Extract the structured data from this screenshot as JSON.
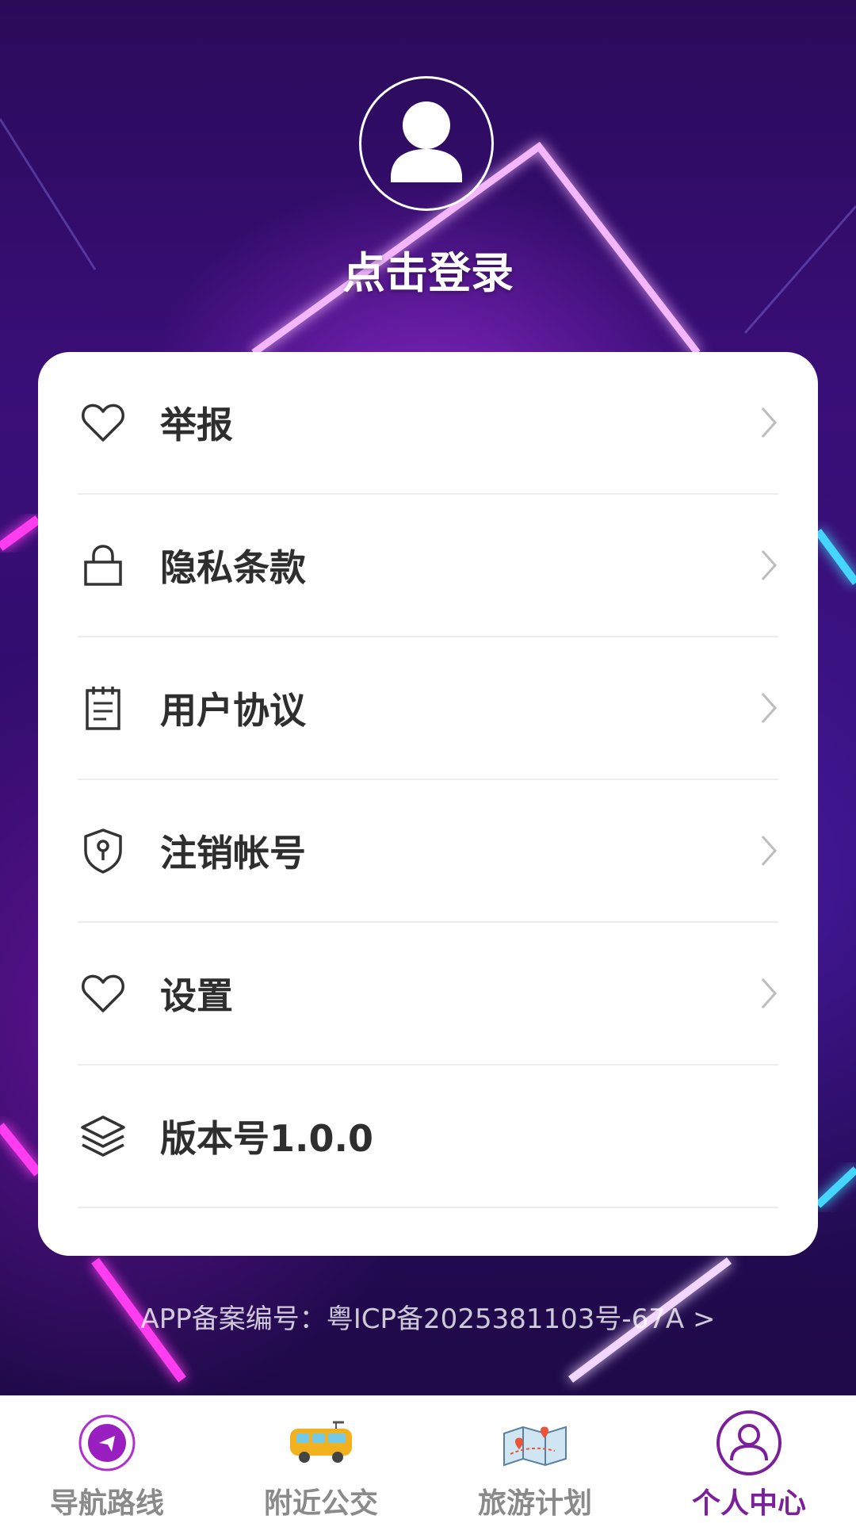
{
  "header": {
    "login_label": "点击登录"
  },
  "menu": {
    "items": [
      {
        "label": "举报",
        "icon": "heart-icon"
      },
      {
        "label": "隐私条款",
        "icon": "lock-icon"
      },
      {
        "label": "用户协议",
        "icon": "notepad-icon"
      },
      {
        "label": "注销帐号",
        "icon": "shield-keyhole-icon"
      },
      {
        "label": "设置",
        "icon": "heart-icon"
      },
      {
        "label": "版本号1.0.0",
        "icon": "layers-icon"
      }
    ]
  },
  "footer": {
    "icp_text": "APP备案编号：粤ICP备2025381103号-67A >"
  },
  "tabbar": {
    "tabs": [
      {
        "label": "导航路线",
        "icon": "navigation-icon"
      },
      {
        "label": "附近公交",
        "icon": "bus-icon"
      },
      {
        "label": "旅游计划",
        "icon": "map-icon"
      },
      {
        "label": "个人中心",
        "icon": "user-icon"
      }
    ],
    "active_index": 3
  },
  "colors": {
    "accent": "#7b1f9a",
    "menu_text": "#2e2e2e",
    "tab_inactive": "#8a8a8a"
  }
}
